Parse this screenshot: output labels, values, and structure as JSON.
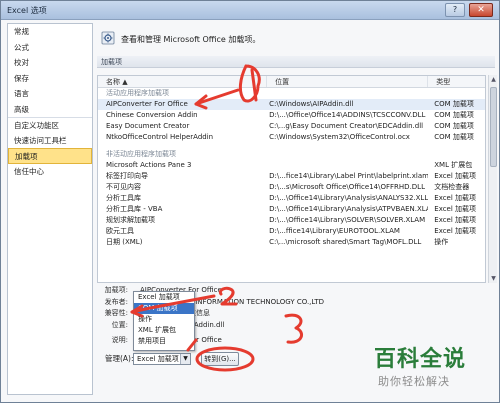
{
  "window": {
    "title": "Excel 选项",
    "help": "?",
    "close": "✕"
  },
  "nav": {
    "items": [
      {
        "label": "常规"
      },
      {
        "label": "公式"
      },
      {
        "label": "校对"
      },
      {
        "label": "保存"
      },
      {
        "label": "语言"
      },
      {
        "label": "高级"
      },
      {
        "label": "自定义功能区"
      },
      {
        "label": "快速访问工具栏"
      },
      {
        "label": "加载项"
      },
      {
        "label": "信任中心"
      }
    ],
    "active_index": 8
  },
  "header": {
    "text": "查看和管理 Microsoft Office 加载项。",
    "icon": "addin-gear-icon"
  },
  "section_title": "加载项",
  "list": {
    "columns": [
      "名称 ▲",
      "位置",
      "类型"
    ],
    "active_group_label": "活动应用程序加载项",
    "active_rows": [
      {
        "name": "AIPConverter For Office",
        "location": "C:\\Windows\\AIPAddin.dll",
        "type": "COM 加载项"
      },
      {
        "name": "Chinese Conversion Addin",
        "location": "D:\\...\\Office\\Office14\\ADDINS\\TCSCCONV.DLL",
        "type": "COM 加载项"
      },
      {
        "name": "Easy Document Creator",
        "location": "C:\\...g\\Easy Document Creator\\EDCAddin.dll",
        "type": "COM 加载项"
      },
      {
        "name": "NtkoOfficeControl HelperAddin",
        "location": "C:\\Windows\\System32\\OfficeControl.ocx",
        "type": "COM 加载项"
      }
    ],
    "inactive_group_label": "非活动应用程序加载项",
    "inactive_rows": [
      {
        "name": "Microsoft Actions Pane 3",
        "location": "",
        "type": "XML 扩展包"
      },
      {
        "name": "标签打印向导",
        "location": "D:\\...fice14\\Library\\Label Print\\labelprint.xlam",
        "type": "Excel 加载项"
      },
      {
        "name": "不可见内容",
        "location": "D:\\...s\\Microsoft Office\\Office14\\OFFRHD.DLL",
        "type": "文档检查器"
      },
      {
        "name": "分析工具库",
        "location": "D:\\...\\Office14\\Library\\Analysis\\ANALYS32.XLL",
        "type": "Excel 加载项"
      },
      {
        "name": "分析工具库 - VBA",
        "location": "D:\\...\\Office14\\Library\\Analysis\\ATPVBAEN.XLAM",
        "type": "Excel 加载项"
      },
      {
        "name": "规划求解加载项",
        "location": "D:\\...\\Office14\\Library\\SOLVER\\SOLVER.XLAM",
        "type": "Excel 加载项"
      },
      {
        "name": "欧元工具",
        "location": "D:\\...ffice14\\Library\\EUROTOOL.XLAM",
        "type": "Excel 加载项"
      },
      {
        "name": "日期 (XML)",
        "location": "C:\\...\\microsoft shared\\Smart Tag\\MOFL.DLL",
        "type": "操作"
      }
    ],
    "selected_index": 0
  },
  "details": {
    "addin_label": "加载项:",
    "addin_value": "AIPConverter For Office",
    "publisher_label": "发布者:",
    "publisher_value": "BEIJING DIANJU INFORMATION TECHNOLOGY CO.,LTD",
    "compat_label": "兼容性:",
    "compat_value": "没有可用的兼容性信息",
    "location_label": "位置:",
    "location_value": "C:\\Windows\\AIPAddin.dll",
    "desc_label": "说明:",
    "desc_value": "AIPConverter For Office"
  },
  "manage": {
    "label": "管理(A):",
    "selected": "Excel 加载项",
    "go_label": "转到(G)...",
    "options": [
      "Excel 加载项",
      "COM 加载项",
      "操作",
      "XML 扩展包",
      "禁用项目"
    ],
    "highlighted_option_index": 1
  },
  "annotations": {
    "marks": [
      "1",
      "2",
      "3"
    ],
    "color": "#e53b2f"
  },
  "watermark": {
    "title": "百科全说",
    "subtitle": "助你轻松解决"
  }
}
